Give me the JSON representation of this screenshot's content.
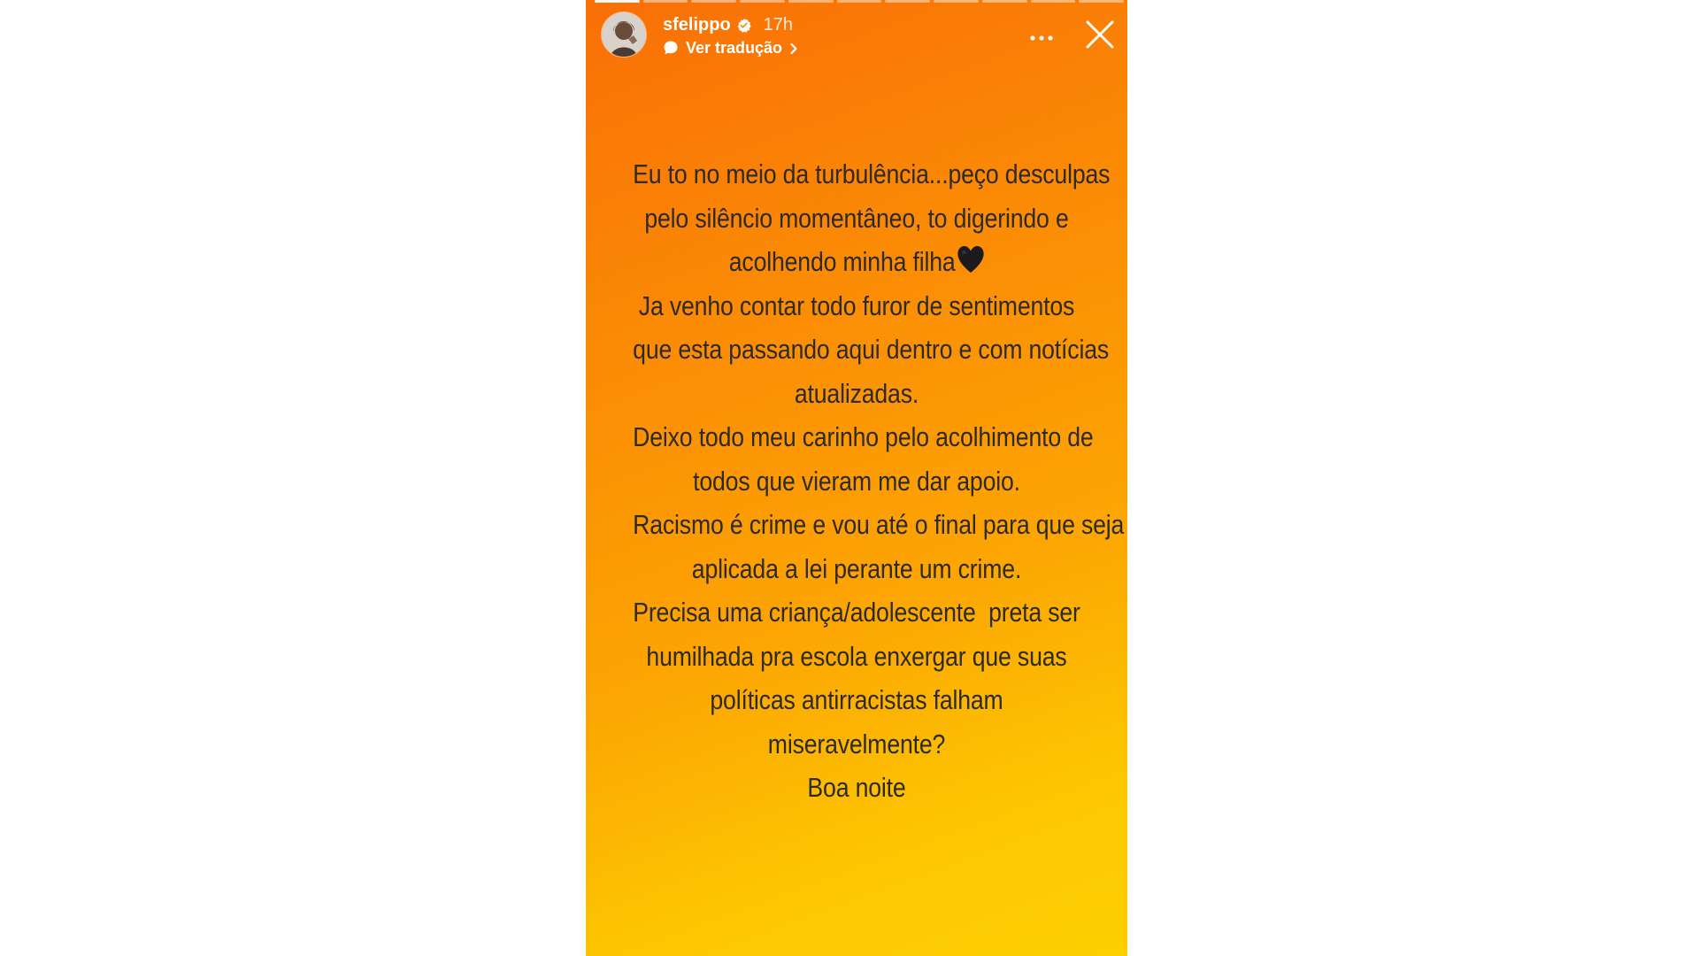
{
  "story": {
    "username": "sfelippo",
    "verified": true,
    "timestamp": "17h",
    "translate_label": "Ver tradução",
    "progress_segments": 11,
    "segments_seen": 1,
    "colors": {
      "gradient_top": "#f96f06",
      "gradient_bottom": "#fecf01",
      "text": "#2e2a26",
      "ui": "#ffffff"
    },
    "icons": {
      "verified": "verified-badge-icon",
      "translate": "speech-bubble-icon",
      "chevron": "chevron-right-icon",
      "more": "more-dots-icon",
      "close": "close-icon",
      "emoji": "black-heart-emoji"
    },
    "lines": [
      "Eu to no meio da turbulência...peço desculpas",
      "pelo silêncio momentâneo, to digerindo e",
      "acolhendo minha filha",
      "Ja venho contar todo furor de sentimentos",
      "que esta passando aqui dentro e com notícias",
      "atualizadas.",
      "Deixo todo meu carinho pelo acolhimento de",
      "todos que vieram me dar apoio.",
      "Racismo é crime e vou até o final para que seja",
      "aplicada a lei perante um crime.",
      "Precisa uma criança/adolescente  preta ser",
      "humilhada pra escola enxergar que suas",
      "políticas antirracistas falham",
      "miseravelmente?",
      "Boa noite"
    ]
  }
}
